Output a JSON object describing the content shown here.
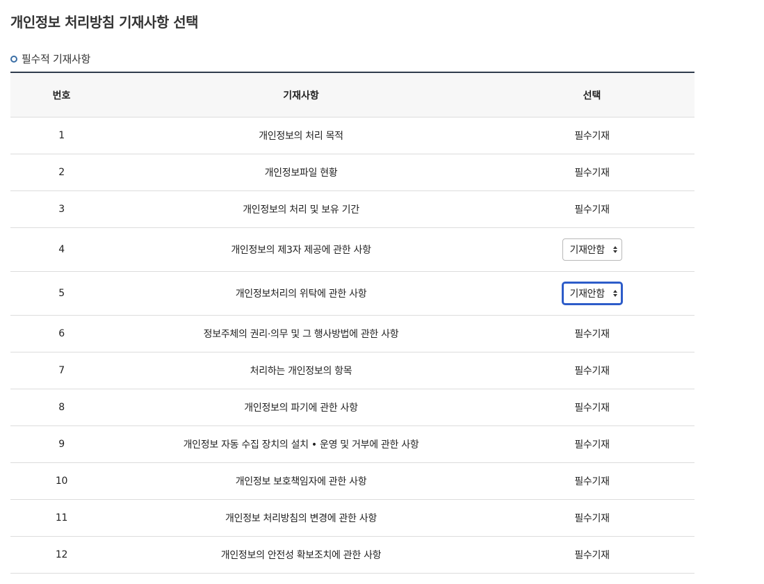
{
  "page_title": "개인정보 처리방침 기재사항 선택",
  "section_title": "필수적 기재사항",
  "table": {
    "headers": {
      "no": "번호",
      "item": "기재사항",
      "select": "선택"
    },
    "rows": [
      {
        "no": "1",
        "item": "개인정보의 처리 목적",
        "select": "필수기재"
      },
      {
        "no": "2",
        "item": "개인정보파일 현황",
        "select": "필수기재"
      },
      {
        "no": "3",
        "item": "개인정보의 처리 및 보유 기간",
        "select": "필수기재"
      },
      {
        "no": "4",
        "item": "개인정보의 제3자 제공에 관한 사항",
        "select": "기재안함"
      },
      {
        "no": "5",
        "item": "개인정보처리의 위탁에 관한 사항",
        "select": "기재안함"
      },
      {
        "no": "6",
        "item": "정보주체의 권리·의무 및 그 행사방법에 관한 사항",
        "select": "필수기재"
      },
      {
        "no": "7",
        "item": "처리하는 개인정보의 항목",
        "select": "필수기재"
      },
      {
        "no": "8",
        "item": "개인정보의 파기에 관한 사항",
        "select": "필수기재"
      },
      {
        "no": "9",
        "item": "개인정보 자동 수집 장치의 설치 • 운영 및 거부에 관한 사항",
        "select": "필수기재"
      },
      {
        "no": "10",
        "item": "개인정보 보호책임자에 관한 사항",
        "select": "필수기재"
      },
      {
        "no": "11",
        "item": "개인정보 처리방침의 변경에 관한 사항",
        "select": "필수기재"
      },
      {
        "no": "12",
        "item": "개인정보의 안전성 확보조치에 관한 사항",
        "select": "필수기재"
      }
    ]
  },
  "colors": {
    "header_border": "#2f3b4c",
    "bullet": "#3a6ea5",
    "focus": "#2d5cc9"
  }
}
